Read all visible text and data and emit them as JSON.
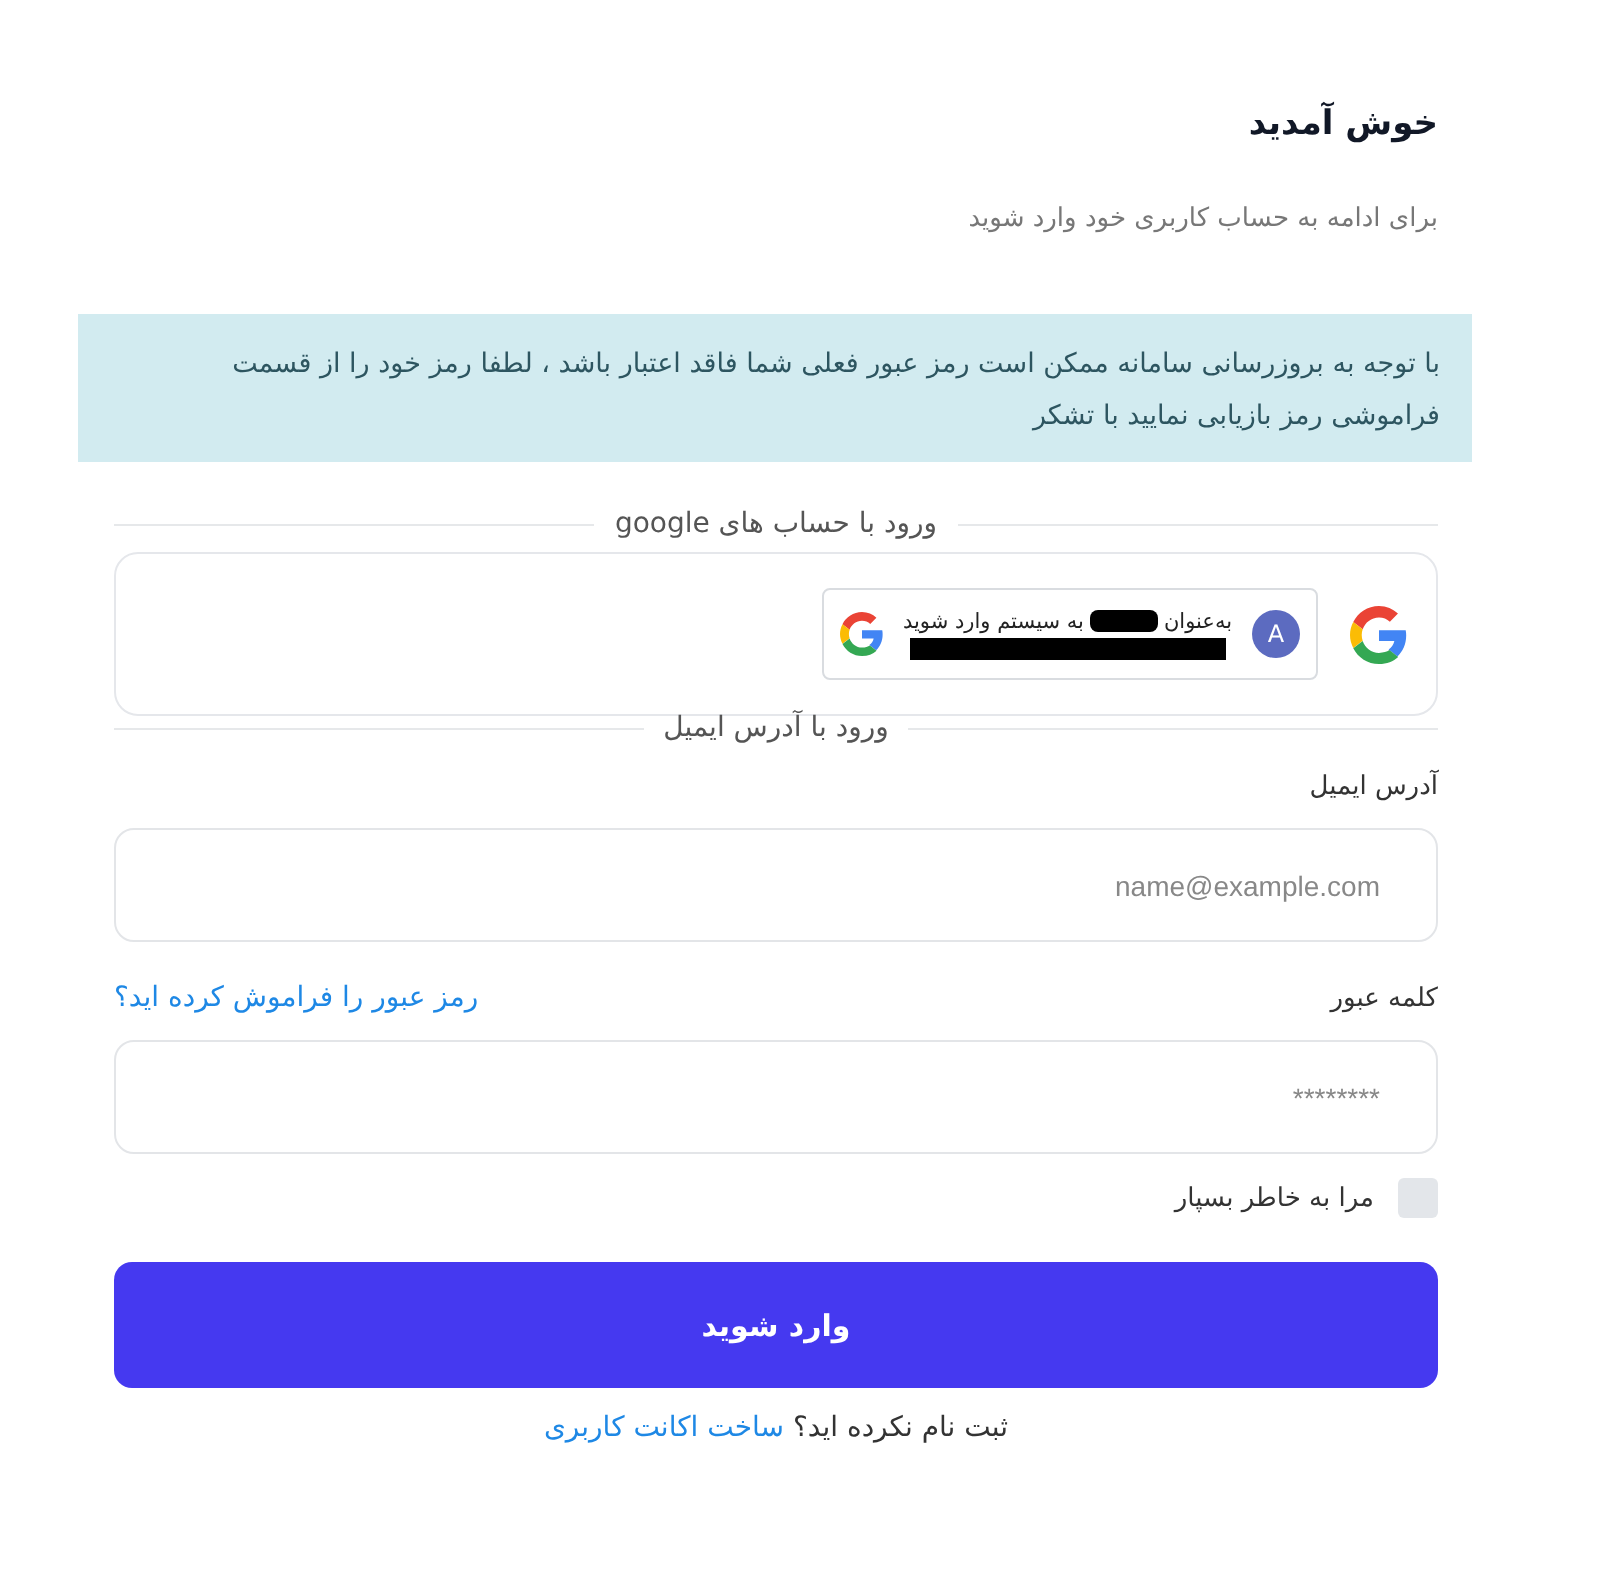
{
  "header": {
    "title": "خوش آمدید",
    "subtitle": "برای ادامه به حساب کاربری خود وارد شوید"
  },
  "notice": "با توجه به بروزرسانی سامانه ممکن است رمز عبور فعلی شما فاقد اعتبار باشد ، لطفا رمز خود را از قسمت فراموشی رمز بازیابی نمایید با تشکر",
  "google_section": {
    "divider_label": "ورود با حساب های google",
    "account_button": {
      "avatar_letter": "A",
      "text_start": "به‌عنوان",
      "text_end": "به سیستم وارد شوید"
    }
  },
  "email_section": {
    "divider_label": "ورود با آدرس ایمیل"
  },
  "email_field": {
    "label": "آدرس ایمیل",
    "placeholder": "name@example.com"
  },
  "password_field": {
    "label": "کلمه عبور",
    "forgot_link": "رمز عبور را فراموش کرده اید؟",
    "placeholder": "********"
  },
  "remember_me": {
    "label": "مرا به خاطر بسپار",
    "checked": false
  },
  "submit_button": "وارد شوید",
  "footer": {
    "text": "ثبت نام نکرده اید؟",
    "link": "ساخت اکانت کاربری"
  }
}
